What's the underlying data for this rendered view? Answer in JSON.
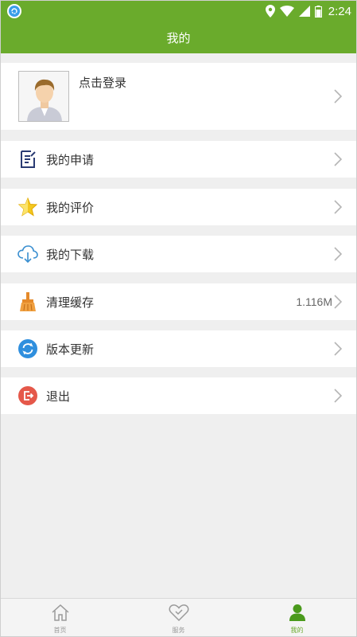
{
  "status_bar": {
    "time": "2:24",
    "icons": [
      "app-notification-icon",
      "location-icon",
      "wifi-icon",
      "signal-icon",
      "battery-icon"
    ]
  },
  "header": {
    "title": "我的"
  },
  "profile": {
    "login_label": "点击登录",
    "icon": "avatar-icon"
  },
  "menu": {
    "items": [
      {
        "label": "我的申请",
        "icon": "application-icon"
      },
      {
        "label": "我的评价",
        "icon": "star-icon"
      },
      {
        "label": "我的下载",
        "icon": "cloud-download-icon"
      },
      {
        "label": "清理缓存",
        "icon": "broom-icon",
        "value": "1.116M"
      },
      {
        "label": "版本更新",
        "icon": "refresh-icon"
      },
      {
        "label": "退出",
        "icon": "logout-icon"
      }
    ]
  },
  "tab_bar": {
    "tabs": [
      {
        "label": "首页",
        "icon": "home-icon",
        "active": false
      },
      {
        "label": "服务",
        "icon": "heart-icon",
        "active": false
      },
      {
        "label": "我的",
        "icon": "person-icon",
        "active": true
      }
    ]
  },
  "colors": {
    "brand": "#6aab2c",
    "background": "#efefef"
  }
}
